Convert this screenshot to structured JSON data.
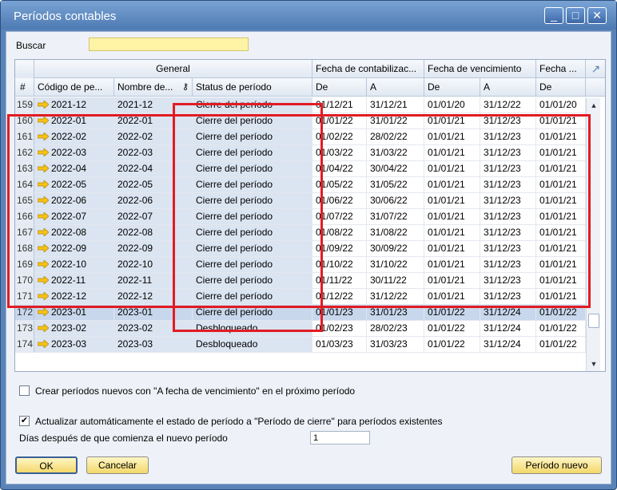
{
  "window": {
    "title": "Períodos contables",
    "controls": {
      "minimize": "_",
      "maximize": "□",
      "close": "✕"
    }
  },
  "search": {
    "label": "Buscar",
    "value": ""
  },
  "grid": {
    "group_headers": [
      "General",
      "Fecha de contabilizac...",
      "Fecha de vencimiento",
      "Fecha ..."
    ],
    "columns": [
      "#",
      "Código de pe...",
      "Nombre de...",
      "Status de período",
      "De",
      "A",
      "De",
      "A",
      "De"
    ],
    "rows": [
      {
        "n": "159",
        "code": "2021-12",
        "name": "2021-12",
        "status": "Cierre del período",
        "pd": "01/12/21",
        "pa": "31/12/21",
        "vd": "01/01/20",
        "va": "31/12/22",
        "fd": "01/01/20"
      },
      {
        "n": "160",
        "code": "2022-01",
        "name": "2022-01",
        "status": "Cierre del período",
        "pd": "01/01/22",
        "pa": "31/01/22",
        "vd": "01/01/21",
        "va": "31/12/23",
        "fd": "01/01/21"
      },
      {
        "n": "161",
        "code": "2022-02",
        "name": "2022-02",
        "status": "Cierre del período",
        "pd": "01/02/22",
        "pa": "28/02/22",
        "vd": "01/01/21",
        "va": "31/12/23",
        "fd": "01/01/21"
      },
      {
        "n": "162",
        "code": "2022-03",
        "name": "2022-03",
        "status": "Cierre del período",
        "pd": "01/03/22",
        "pa": "31/03/22",
        "vd": "01/01/21",
        "va": "31/12/23",
        "fd": "01/01/21"
      },
      {
        "n": "163",
        "code": "2022-04",
        "name": "2022-04",
        "status": "Cierre del período",
        "pd": "01/04/22",
        "pa": "30/04/22",
        "vd": "01/01/21",
        "va": "31/12/23",
        "fd": "01/01/21"
      },
      {
        "n": "164",
        "code": "2022-05",
        "name": "2022-05",
        "status": "Cierre del período",
        "pd": "01/05/22",
        "pa": "31/05/22",
        "vd": "01/01/21",
        "va": "31/12/23",
        "fd": "01/01/21"
      },
      {
        "n": "165",
        "code": "2022-06",
        "name": "2022-06",
        "status": "Cierre del período",
        "pd": "01/06/22",
        "pa": "30/06/22",
        "vd": "01/01/21",
        "va": "31/12/23",
        "fd": "01/01/21"
      },
      {
        "n": "166",
        "code": "2022-07",
        "name": "2022-07",
        "status": "Cierre del período",
        "pd": "01/07/22",
        "pa": "31/07/22",
        "vd": "01/01/21",
        "va": "31/12/23",
        "fd": "01/01/21"
      },
      {
        "n": "167",
        "code": "2022-08",
        "name": "2022-08",
        "status": "Cierre del período",
        "pd": "01/08/22",
        "pa": "31/08/22",
        "vd": "01/01/21",
        "va": "31/12/23",
        "fd": "01/01/21"
      },
      {
        "n": "168",
        "code": "2022-09",
        "name": "2022-09",
        "status": "Cierre del período",
        "pd": "01/09/22",
        "pa": "30/09/22",
        "vd": "01/01/21",
        "va": "31/12/23",
        "fd": "01/01/21"
      },
      {
        "n": "169",
        "code": "2022-10",
        "name": "2022-10",
        "status": "Cierre del período",
        "pd": "01/10/22",
        "pa": "31/10/22",
        "vd": "01/01/21",
        "va": "31/12/23",
        "fd": "01/01/21"
      },
      {
        "n": "170",
        "code": "2022-11",
        "name": "2022-11",
        "status": "Cierre del período",
        "pd": "01/11/22",
        "pa": "30/11/22",
        "vd": "01/01/21",
        "va": "31/12/23",
        "fd": "01/01/21"
      },
      {
        "n": "171",
        "code": "2022-12",
        "name": "2022-12",
        "status": "Cierre del período",
        "pd": "01/12/22",
        "pa": "31/12/22",
        "vd": "01/01/21",
        "va": "31/12/23",
        "fd": "01/01/21"
      },
      {
        "n": "172",
        "code": "2023-01",
        "name": "2023-01",
        "status": "Cierre del período",
        "pd": "01/01/23",
        "pa": "31/01/23",
        "vd": "01/01/22",
        "va": "31/12/24",
        "fd": "01/01/22"
      },
      {
        "n": "173",
        "code": "2023-02",
        "name": "2023-02",
        "status": "Desbloqueado",
        "pd": "01/02/23",
        "pa": "28/02/23",
        "vd": "01/01/22",
        "va": "31/12/24",
        "fd": "01/01/22"
      },
      {
        "n": "174",
        "code": "2023-03",
        "name": "2023-03",
        "status": "Desbloqueado",
        "pd": "01/03/23",
        "pa": "31/03/23",
        "vd": "01/01/22",
        "va": "31/12/24",
        "fd": "01/01/22"
      }
    ]
  },
  "options": {
    "create_new_periods": {
      "checked": false,
      "label": "Crear períodos nuevos con \"A fecha de vencimiento\" en el próximo período"
    },
    "auto_update_status": {
      "checked": true,
      "label": "Actualizar automáticamente el estado de período a \"Período de cierre\" para períodos existentes"
    },
    "days_after_label": "Días después de que comienza el nuevo período",
    "days_after_value": "1"
  },
  "buttons": {
    "ok": "OK",
    "cancel": "Cancelar",
    "new_period": "Período nuevo"
  },
  "colors": {
    "annotation": "#e21b23",
    "title_bar": "#5a84b8",
    "button": "#f3d86a"
  }
}
